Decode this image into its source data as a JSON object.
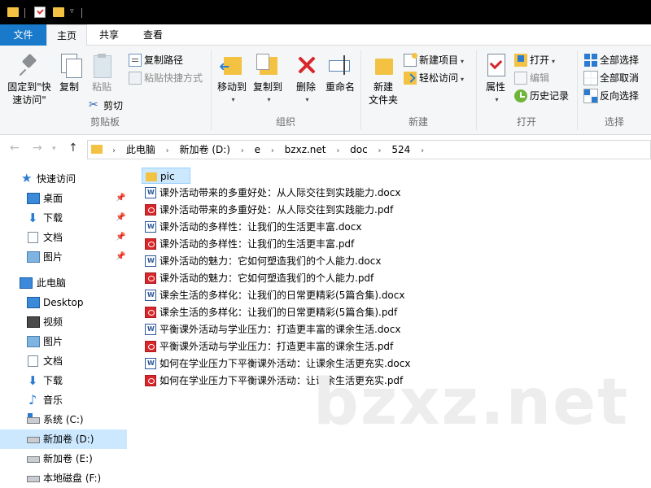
{
  "ribbon_tabs": [
    "文件",
    "主页",
    "共享",
    "查看"
  ],
  "clipboard": {
    "pin_label": "固定到\"快\n速访问\"",
    "pin_line1": "固定到\"快",
    "pin_line2": "速访问\"",
    "copy": "复制",
    "paste": "粘贴",
    "copy_path": "复制路径",
    "paste_shortcut": "粘贴快捷方式",
    "cut": "剪切",
    "group_label": "剪贴板"
  },
  "organize": {
    "move_to": "移动到",
    "copy_to": "复制到",
    "delete": "删除",
    "rename": "重命名",
    "group_label": "组织"
  },
  "new": {
    "new_folder_line1": "新建",
    "new_folder_line2": "文件夹",
    "new_item": "新建项目",
    "easy_access": "轻松访问",
    "group_label": "新建"
  },
  "open": {
    "properties": "属性",
    "open": "打开",
    "edit": "编辑",
    "history": "历史记录",
    "group_label": "打开"
  },
  "select": {
    "select_all": "全部选择",
    "select_none": "全部取消",
    "invert": "反向选择",
    "group_label": "选择"
  },
  "breadcrumb": [
    "此电脑",
    "新加卷 (D:)",
    "e",
    "bzxz.net",
    "doc",
    "524"
  ],
  "nav_pane": {
    "quick_access": "快速访问",
    "quick_items": [
      {
        "label": "桌面",
        "icon": "desktop-icon"
      },
      {
        "label": "下载",
        "icon": "download-icon"
      },
      {
        "label": "文档",
        "icon": "documents-icon"
      },
      {
        "label": "图片",
        "icon": "pictures-icon"
      }
    ],
    "this_pc": "此电脑",
    "pc_items": [
      {
        "label": "Desktop",
        "icon": "desktop-icon"
      },
      {
        "label": "视频",
        "icon": "video-icon"
      },
      {
        "label": "图片",
        "icon": "pictures-icon"
      },
      {
        "label": "文档",
        "icon": "documents-icon"
      },
      {
        "label": "下载",
        "icon": "download-icon"
      },
      {
        "label": "音乐",
        "icon": "music-icon"
      },
      {
        "label": "系统 (C:)",
        "icon": "drive-icon"
      },
      {
        "label": "新加卷 (D:)",
        "icon": "drive-icon"
      },
      {
        "label": "新加卷 (E:)",
        "icon": "drive-icon"
      },
      {
        "label": "本地磁盘 (F:)",
        "icon": "drive-icon"
      }
    ],
    "selected": "新加卷 (D:)"
  },
  "files": [
    {
      "name": "pic",
      "type": "folder"
    },
    {
      "name": "课外活动带来的多重好处：从人际交往到实践能力.docx",
      "type": "docx"
    },
    {
      "name": "课外活动带来的多重好处：从人际交往到实践能力.pdf",
      "type": "pdf"
    },
    {
      "name": "课外活动的多样性：让我们的生活更丰富.docx",
      "type": "docx"
    },
    {
      "name": "课外活动的多样性：让我们的生活更丰富.pdf",
      "type": "pdf"
    },
    {
      "name": "课外活动的魅力：它如何塑造我们的个人能力.docx",
      "type": "docx"
    },
    {
      "name": "课外活动的魅力：它如何塑造我们的个人能力.pdf",
      "type": "pdf"
    },
    {
      "name": "课余生活的多样化：让我们的日常更精彩(5篇合集).docx",
      "type": "docx"
    },
    {
      "name": "课余生活的多样化：让我们的日常更精彩(5篇合集).pdf",
      "type": "pdf"
    },
    {
      "name": "平衡课外活动与学业压力：打造更丰富的课余生活.docx",
      "type": "docx"
    },
    {
      "name": "平衡课外活动与学业压力：打造更丰富的课余生活.pdf",
      "type": "pdf"
    },
    {
      "name": "如何在学业压力下平衡课外活动：让课余生活更充实.docx",
      "type": "docx"
    },
    {
      "name": "如何在学业压力下平衡课外活动：让课余生活更充实.pdf",
      "type": "pdf"
    }
  ],
  "watermark": "bzxz.net"
}
